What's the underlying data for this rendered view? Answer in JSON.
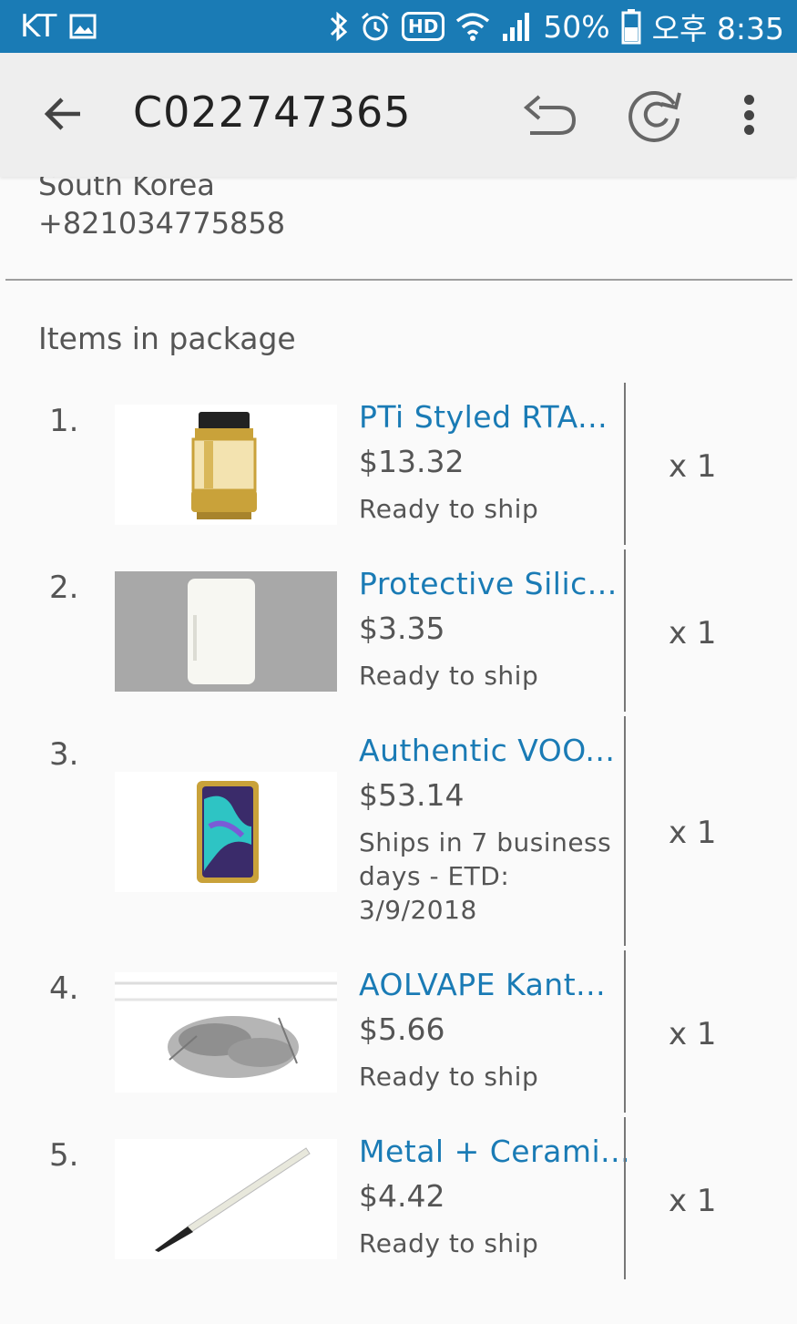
{
  "status_bar": {
    "carrier": "KT",
    "battery_pct": "50%",
    "time": "오후 8:35",
    "hd": "HD",
    "icons": [
      "image-icon",
      "bluetooth-icon",
      "alarm-icon",
      "hd-icon",
      "wifi-icon",
      "signal-icon",
      "battery-icon"
    ]
  },
  "app_bar": {
    "title": "C022747365",
    "icons": [
      "back-arrow-icon",
      "undo-icon",
      "refresh-icon",
      "more-vert-icon"
    ]
  },
  "address": {
    "country": "South Korea",
    "phone": "+821034775858"
  },
  "section": {
    "title": "Items in package"
  },
  "items": [
    {
      "num": "1.",
      "title": "PTi Styled RTA...",
      "price": "$13.32",
      "status": "Ready to ship",
      "qty": "x 1"
    },
    {
      "num": "2.",
      "title": "Protective Silic...",
      "price": "$3.35",
      "status": "Ready to ship",
      "qty": "x 1"
    },
    {
      "num": "3.",
      "title": "Authentic VOO...",
      "price": "$53.14",
      "status": "Ships in 7 business days - ETD: 3/9/2018",
      "qty": "x 1"
    },
    {
      "num": "4.",
      "title": "AOLVAPE Kant...",
      "price": "$5.66",
      "status": "Ready to ship",
      "qty": "x 1"
    },
    {
      "num": "5.",
      "title": "Metal + Cerami...",
      "price": "$4.42",
      "status": "Ready to ship",
      "qty": "x 1"
    }
  ],
  "colors": {
    "status_bar": "#1a7bb5",
    "app_bar": "#eeeeee",
    "link": "#1a7bb5",
    "text": "#555555"
  }
}
